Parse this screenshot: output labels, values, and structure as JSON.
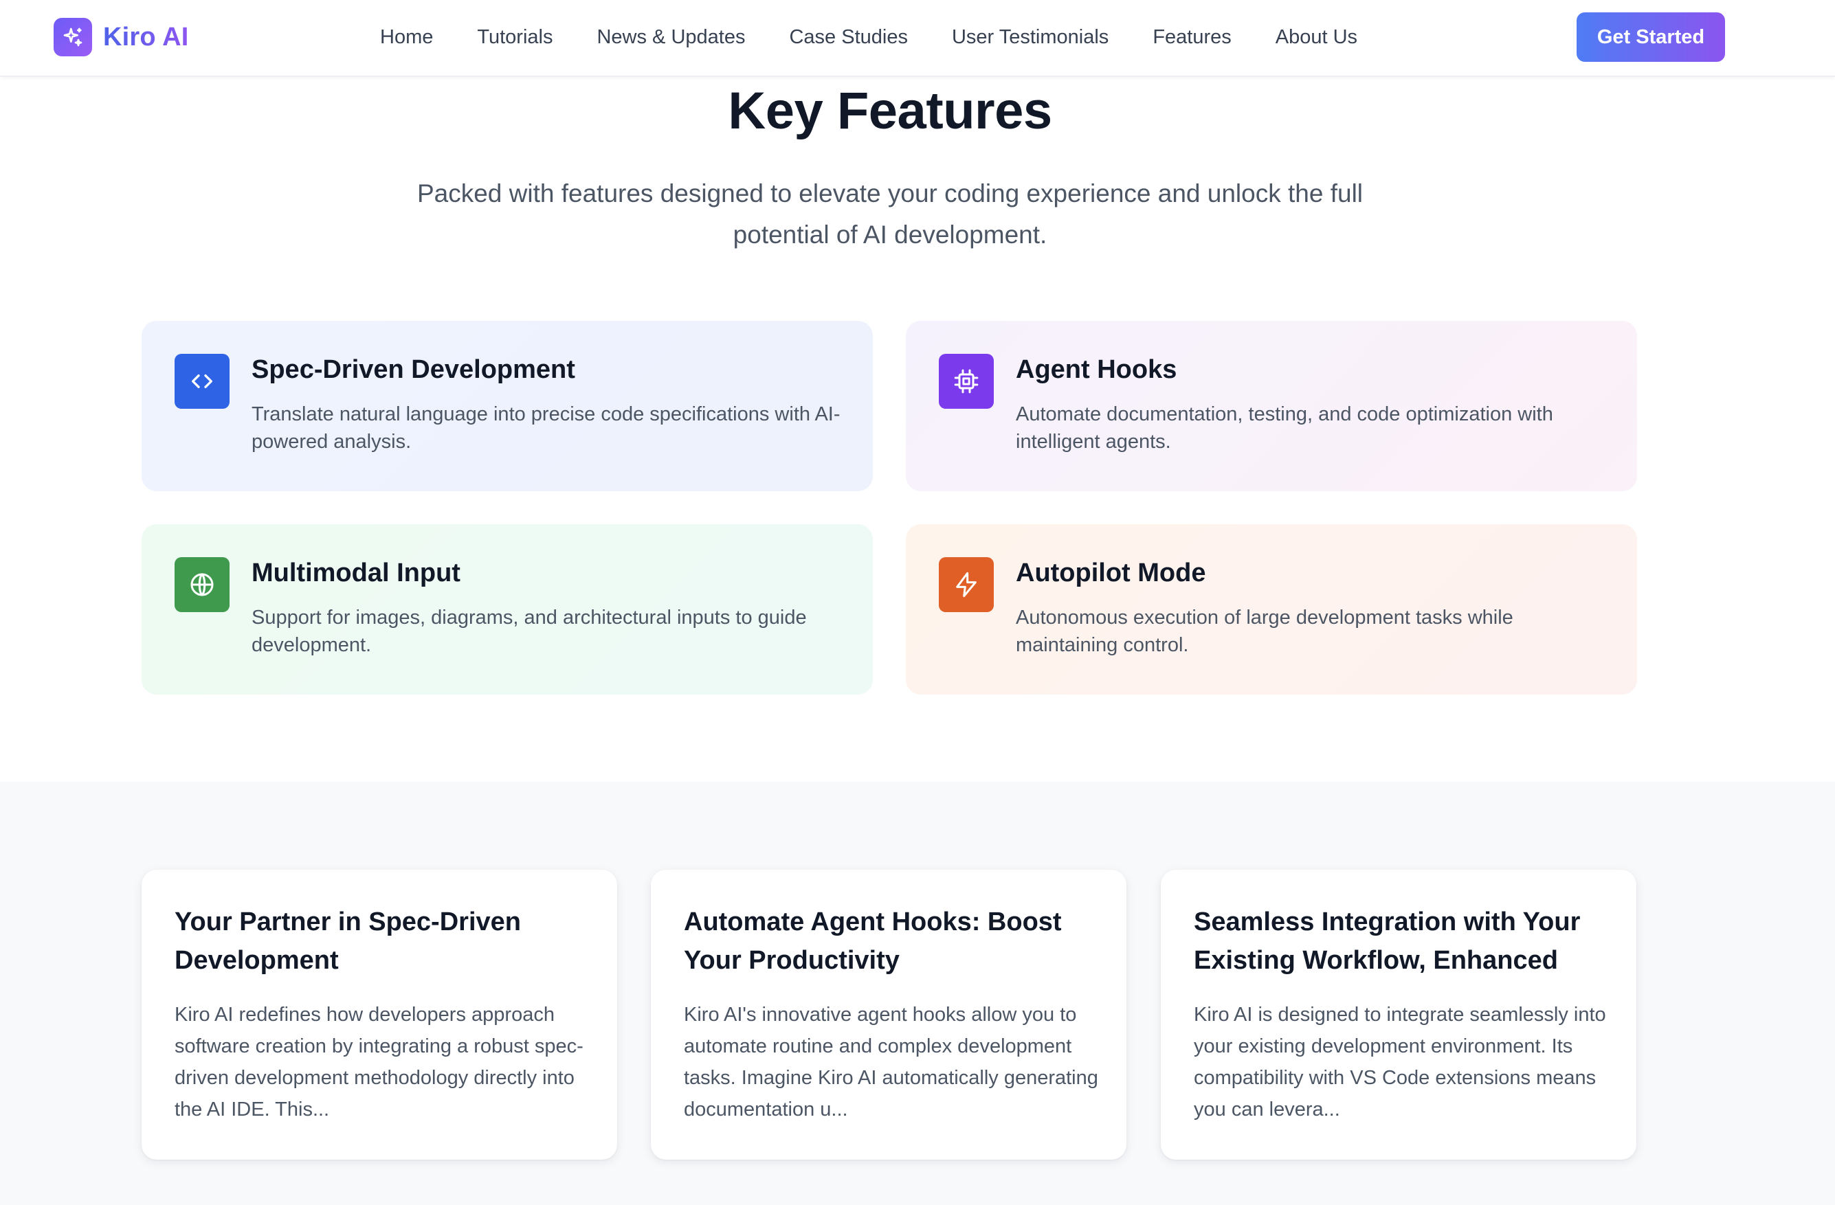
{
  "brand": {
    "name": "Kiro AI",
    "logo_icon": "sparkles-icon"
  },
  "nav": {
    "items": [
      "Home",
      "Tutorials",
      "News & Updates",
      "Case Studies",
      "User Testimonials",
      "Features",
      "About Us"
    ]
  },
  "cta": {
    "label": "Get Started"
  },
  "key_features": {
    "title": "Key Features",
    "subtitle": "Packed with features designed to elevate your coding experience and unlock the full potential of AI development.",
    "items": [
      {
        "title": "Spec-Driven Development",
        "description": "Translate natural language into precise code specifications with AI-powered analysis.",
        "icon": "code-icon",
        "accent": "#2f63e6"
      },
      {
        "title": "Agent Hooks",
        "description": "Automate documentation, testing, and code optimization with intelligent agents.",
        "icon": "cpu-icon",
        "accent": "#7c3aed"
      },
      {
        "title": "Multimodal Input",
        "description": "Support for images, diagrams, and architectural inputs to guide development.",
        "icon": "globe-icon",
        "accent": "#3f9a4d"
      },
      {
        "title": "Autopilot Mode",
        "description": "Autonomous execution of large development tasks while maintaining control.",
        "icon": "lightning-icon",
        "accent": "#df5f27"
      }
    ]
  },
  "articles": [
    {
      "title": "Your Partner in Spec-Driven Development",
      "excerpt": "Kiro AI redefines how developers approach software creation by integrating a robust spec-driven development methodology directly into the AI IDE. This..."
    },
    {
      "title": "Automate Agent Hooks: Boost Your Productivity",
      "excerpt": "Kiro AI's innovative agent hooks allow you to automate routine and complex development tasks. Imagine Kiro AI automatically generating documentation u..."
    },
    {
      "title": "Seamless Integration with Your Existing Workflow, Enhanced",
      "excerpt": "Kiro AI is designed to integrate seamlessly into your existing development environment. Its compatibility with VS Code extensions means you can levera..."
    }
  ]
}
